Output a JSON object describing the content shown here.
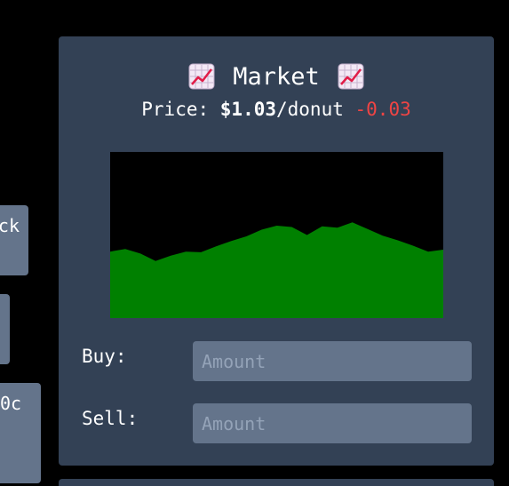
{
  "left_buttons": [
    {
      "label": "ck"
    },
    {
      "label": ""
    },
    {
      "label": "0c"
    }
  ],
  "market": {
    "title": "Market",
    "icon": "chart-increasing-emoji",
    "price_label": "Price: ",
    "price_value": "$1.03",
    "price_unit": "/donut",
    "price_change": "-0.03",
    "price_change_color": "#ef4444"
  },
  "chart_data": {
    "type": "area",
    "color": "#008000",
    "background": "#000000",
    "values": [
      1.0,
      1.04,
      0.97,
      0.86,
      0.94,
      1.0,
      0.99,
      1.08,
      1.16,
      1.23,
      1.33,
      1.39,
      1.37,
      1.25,
      1.38,
      1.36,
      1.44,
      1.34,
      1.24,
      1.17,
      1.09,
      1.0,
      1.03
    ],
    "ylim": [
      0,
      2.5
    ]
  },
  "trade": {
    "buy_label": "Buy:",
    "buy_placeholder": "Amount",
    "sell_label": "Sell:",
    "sell_placeholder": "Amount"
  }
}
